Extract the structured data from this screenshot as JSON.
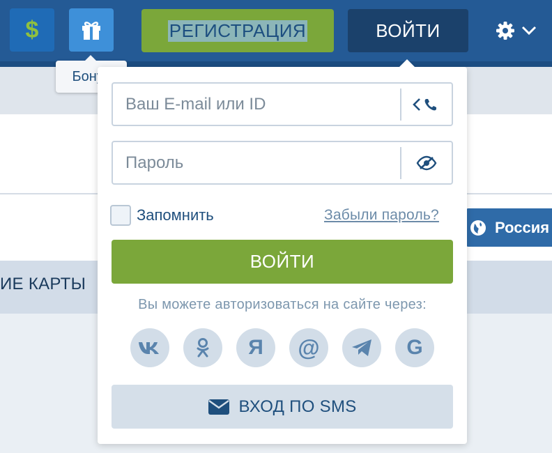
{
  "header": {
    "dollar_icon_glyph": "$",
    "gift_icon": "gift-icon",
    "register_label": "РЕГИСТРАЦИЯ",
    "login_label": "ВОЙТИ",
    "settings_icon": "gear-icon"
  },
  "tooltip": {
    "text": "Бонус"
  },
  "background": {
    "menu_text": "ИЕ КАРТЫ",
    "country_label": "Россия"
  },
  "login_popup": {
    "email_placeholder": "Ваш E-mail или ID",
    "password_placeholder": "Пароль",
    "remember_label": "Запомнить",
    "forgot_link": "Забыли пароль?",
    "submit_label": "ВОЙТИ",
    "auth_via_text": "Вы можете авторизоваться на сайте через:",
    "social_glyphs": {
      "vk": "vk",
      "ok": "ok",
      "yandex": "Я",
      "mail": "@",
      "telegram": "telegram",
      "google": "G"
    },
    "sms_label": "ВХОД ПО SMS"
  },
  "colors": {
    "header_bg": "#245a95",
    "green": "#7ba73a",
    "dark_blue": "#1b416b",
    "text_blue": "#1f4f7d"
  }
}
